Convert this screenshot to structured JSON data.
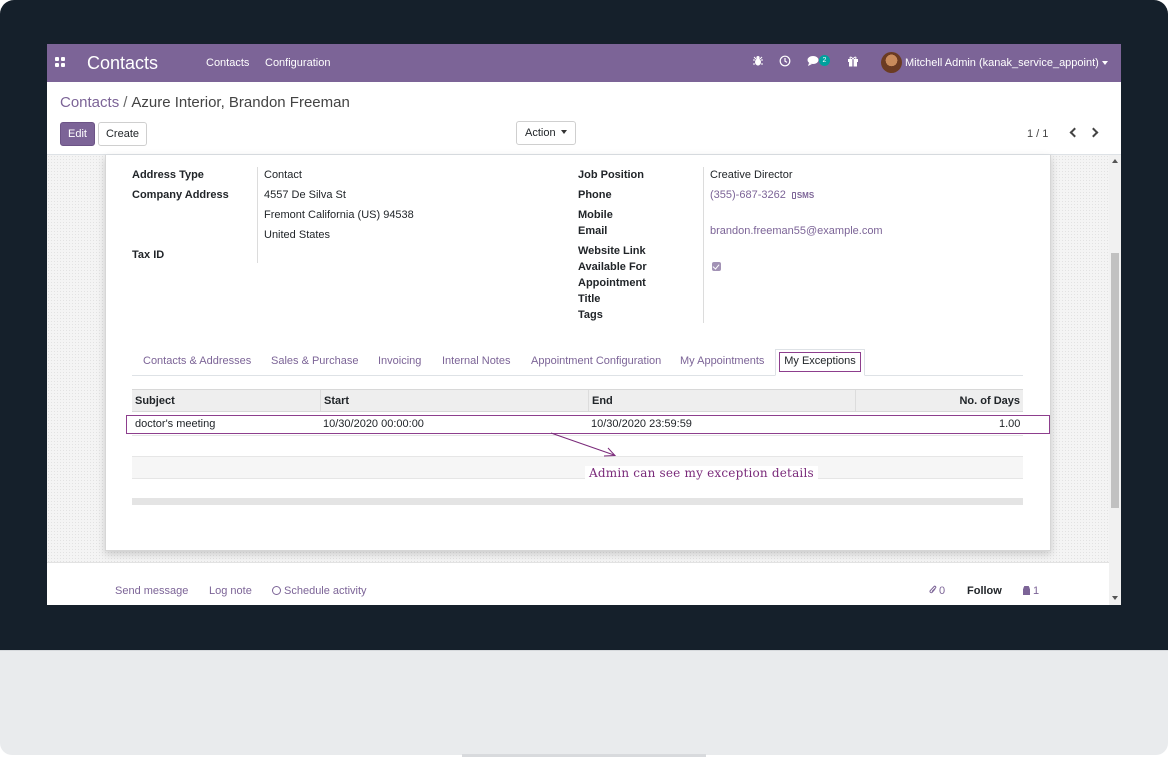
{
  "navbar": {
    "app_title": "Contacts",
    "menu": [
      "Contacts",
      "Configuration"
    ],
    "chat_count": "2",
    "user": "Mitchell Admin (kanak_service_appoint)",
    "icons": [
      "apps-grid-icon",
      "bug-icon",
      "clock-icon",
      "chat-icon",
      "gift-icon"
    ]
  },
  "breadcrumb": {
    "parent": "Contacts",
    "separator": "/",
    "current": "Azure Interior, Brandon Freeman"
  },
  "buttons": {
    "edit": "Edit",
    "create": "Create",
    "action": "Action"
  },
  "pager": {
    "value": "1 / 1"
  },
  "form": {
    "left": {
      "address_type_label": "Address Type",
      "address_type": "Contact",
      "company_address_label": "Company Address",
      "street": "4557 De Silva St",
      "city_line": "Fremont  California (US)  94538",
      "country": "United States",
      "tax_id_label": "Tax ID"
    },
    "right": {
      "job_position_label": "Job Position",
      "job_position": "Creative Director",
      "phone_label": "Phone",
      "phone": "(355)-687-3262",
      "sms": "SMS",
      "mobile_label": "Mobile",
      "email_label": "Email",
      "email": "brandon.freeman55@example.com",
      "website_label": "Website Link",
      "available_label_1": "Available For",
      "available_label_2": "Appointment",
      "available_for_appointment": true,
      "title_label": "Title",
      "tags_label": "Tags"
    }
  },
  "tabs": [
    "Contacts & Addresses",
    "Sales & Purchase",
    "Invoicing",
    "Internal Notes",
    "Appointment Configuration",
    "My Appointments",
    "My Exceptions"
  ],
  "active_tab": "My Exceptions",
  "table": {
    "columns": [
      "Subject",
      "Start",
      "End",
      "No. of Days"
    ],
    "rows": [
      [
        "doctor's meeting",
        "10/30/2020 00:00:00",
        "10/30/2020 23:59:59",
        "1.00"
      ]
    ]
  },
  "annotation": "Admin can see my exception details",
  "chatter": {
    "send_message": "Send message",
    "log_note": "Log note",
    "schedule_activity": "Schedule activity",
    "attachments": "0",
    "follow": "Follow",
    "followers": "1"
  },
  "colors": {
    "brand": "#7c6497",
    "highlight": "#8d3e8d",
    "frame": "#15202b"
  }
}
